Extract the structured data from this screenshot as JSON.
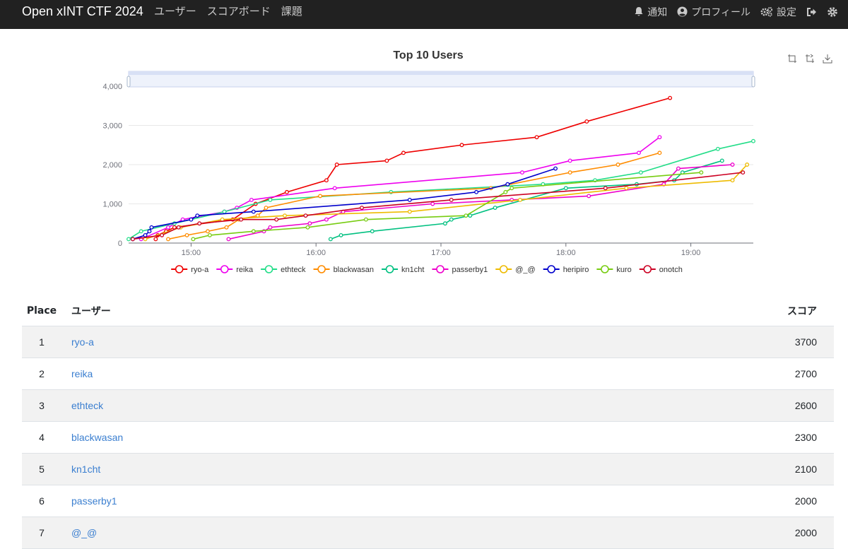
{
  "nav": {
    "brand": "Open xINT CTF 2024",
    "links": [
      "ユーザー",
      "スコアボード",
      "課題"
    ],
    "notifications": "通知",
    "profile": "プロフィール",
    "settings": "設定"
  },
  "chart_data": {
    "type": "line",
    "title": "Top 10 Users",
    "ylim": [
      0,
      4000
    ],
    "yticks": [
      "0",
      "1,000",
      "2,000",
      "3,000",
      "4,000"
    ],
    "xticks": [
      "15:00",
      "16:00",
      "17:00",
      "18:00",
      "19:00"
    ],
    "xlim": [
      "14:30",
      "19:30"
    ],
    "legend_position": "bottom",
    "series": [
      {
        "name": "ryo-a",
        "color": "#ee0000",
        "points": [
          [
            "14:43",
            100
          ],
          [
            "14:44",
            200
          ],
          [
            "14:48",
            300
          ],
          [
            "14:52",
            400
          ],
          [
            "15:20",
            600
          ],
          [
            "15:31",
            1000
          ],
          [
            "15:46",
            1300
          ],
          [
            "16:05",
            1600
          ],
          [
            "16:10",
            2000
          ],
          [
            "16:34",
            2100
          ],
          [
            "16:42",
            2300
          ],
          [
            "17:10",
            2500
          ],
          [
            "17:46",
            2700
          ],
          [
            "18:10",
            3100
          ],
          [
            "18:50",
            3700
          ]
        ]
      },
      {
        "name": "reika",
        "color": "#ee00ee",
        "points": [
          [
            "14:36",
            100
          ],
          [
            "14:49",
            400
          ],
          [
            "14:56",
            600
          ],
          [
            "15:16",
            800
          ],
          [
            "15:22",
            900
          ],
          [
            "15:29",
            1100
          ],
          [
            "16:09",
            1400
          ],
          [
            "17:39",
            1800
          ],
          [
            "18:02",
            2100
          ],
          [
            "18:35",
            2300
          ],
          [
            "18:45",
            2700
          ]
        ]
      },
      {
        "name": "ethteck",
        "color": "#22dd88",
        "points": [
          [
            "14:30",
            100
          ],
          [
            "14:36",
            300
          ],
          [
            "14:52",
            500
          ],
          [
            "15:16",
            800
          ],
          [
            "15:38",
            1100
          ],
          [
            "16:36",
            1300
          ],
          [
            "17:49",
            1500
          ],
          [
            "18:14",
            1600
          ],
          [
            "18:36",
            1800
          ],
          [
            "19:13",
            2400
          ],
          [
            "19:30",
            2600
          ]
        ]
      },
      {
        "name": "blackwasan",
        "color": "#ff8c00",
        "points": [
          [
            "14:49",
            100
          ],
          [
            "14:58",
            200
          ],
          [
            "15:08",
            300
          ],
          [
            "15:17",
            400
          ],
          [
            "15:23",
            600
          ],
          [
            "15:32",
            700
          ],
          [
            "15:36",
            900
          ],
          [
            "16:02",
            1200
          ],
          [
            "17:24",
            1400
          ],
          [
            "18:02",
            1800
          ],
          [
            "18:25",
            2000
          ],
          [
            "18:45",
            2300
          ]
        ]
      },
      {
        "name": "kn1cht",
        "color": "#00c080",
        "points": [
          [
            "16:07",
            100
          ],
          [
            "16:12",
            200
          ],
          [
            "16:27",
            300
          ],
          [
            "17:02",
            500
          ],
          [
            "17:05",
            600
          ],
          [
            "17:14",
            700
          ],
          [
            "17:26",
            900
          ],
          [
            "18:00",
            1400
          ],
          [
            "18:34",
            1500
          ],
          [
            "18:52",
            1600
          ],
          [
            "18:56",
            1800
          ],
          [
            "19:15",
            2100
          ]
        ]
      },
      {
        "name": "passerby1",
        "color": "#ee00cc",
        "points": [
          [
            "15:18",
            100
          ],
          [
            "15:35",
            300
          ],
          [
            "15:38",
            400
          ],
          [
            "15:57",
            500
          ],
          [
            "16:05",
            600
          ],
          [
            "16:13",
            800
          ],
          [
            "16:56",
            1000
          ],
          [
            "17:34",
            1100
          ],
          [
            "18:11",
            1200
          ],
          [
            "18:47",
            1500
          ],
          [
            "18:54",
            1900
          ],
          [
            "19:20",
            2000
          ]
        ]
      },
      {
        "name": "@_@",
        "color": "#eebb00",
        "points": [
          [
            "14:38",
            100
          ],
          [
            "14:55",
            400
          ],
          [
            "15:15",
            600
          ],
          [
            "15:45",
            700
          ],
          [
            "16:45",
            800
          ],
          [
            "17:38",
            1100
          ],
          [
            "18:29",
            1400
          ],
          [
            "19:20",
            1600
          ],
          [
            "19:27",
            2000
          ]
        ]
      },
      {
        "name": "heripiro",
        "color": "#0000cc",
        "points": [
          [
            "14:32",
            100
          ],
          [
            "14:38",
            200
          ],
          [
            "14:40",
            300
          ],
          [
            "14:41",
            400
          ],
          [
            "15:00",
            600
          ],
          [
            "15:03",
            700
          ],
          [
            "15:30",
            800
          ],
          [
            "16:45",
            1100
          ],
          [
            "17:17",
            1300
          ],
          [
            "17:32",
            1500
          ],
          [
            "17:55",
            1900
          ]
        ]
      },
      {
        "name": "kuro",
        "color": "#77cc11",
        "points": [
          [
            "15:01",
            100
          ],
          [
            "15:09",
            200
          ],
          [
            "15:30",
            300
          ],
          [
            "15:56",
            400
          ],
          [
            "16:24",
            600
          ],
          [
            "17:12",
            700
          ],
          [
            "17:31",
            1300
          ],
          [
            "17:34",
            1400
          ],
          [
            "19:05",
            1800
          ]
        ]
      },
      {
        "name": "onotch",
        "color": "#cc0022",
        "points": [
          [
            "14:32",
            100
          ],
          [
            "14:46",
            200
          ],
          [
            "14:54",
            400
          ],
          [
            "15:04",
            500
          ],
          [
            "15:24",
            600
          ],
          [
            "15:41",
            600
          ],
          [
            "15:55",
            700
          ],
          [
            "16:22",
            900
          ],
          [
            "17:05",
            1100
          ],
          [
            "18:19",
            1400
          ],
          [
            "19:25",
            1800
          ]
        ]
      }
    ]
  },
  "table": {
    "headers": {
      "place": "Place",
      "user": "ユーザー",
      "score": "スコア"
    },
    "rows": [
      {
        "place": "1",
        "user": "ryo-a",
        "score": "3700"
      },
      {
        "place": "2",
        "user": "reika",
        "score": "2700"
      },
      {
        "place": "3",
        "user": "ethteck",
        "score": "2600"
      },
      {
        "place": "4",
        "user": "blackwasan",
        "score": "2300"
      },
      {
        "place": "5",
        "user": "kn1cht",
        "score": "2100"
      },
      {
        "place": "6",
        "user": "passerby1",
        "score": "2000"
      },
      {
        "place": "7",
        "user": "@_@",
        "score": "2000"
      }
    ]
  }
}
